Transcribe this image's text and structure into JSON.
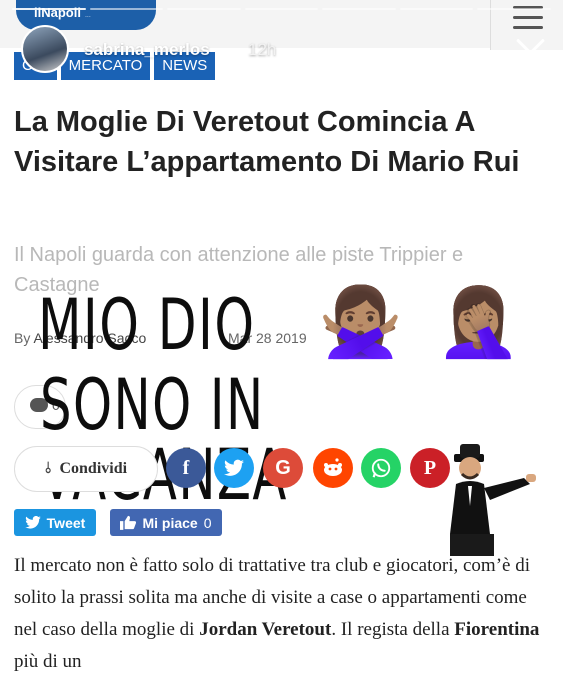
{
  "story": {
    "username": "sabrina_merlos",
    "time": "12h"
  },
  "site": {
    "logo": "ilNapoli",
    "logo_sub": "..."
  },
  "article": {
    "tags": [
      "CIO",
      "MERCATO",
      "NEWS"
    ],
    "title": "La Moglie Di Veretout Comincia A Visitare L’appartamento Di Mario Rui",
    "subtitle": "Il Napoli guarda con attenzione alle piste Trippier e Castagne",
    "byline_prefix": "By",
    "author": "Alessandro Sacco",
    "date": "Mar 28 2019",
    "comments_count": "0",
    "share_label": "Condividi",
    "tweet_label": "Tweet",
    "like_label": "Mi piace",
    "like_count": "0",
    "body": {
      "p1": "Il mercato non è fatto solo di trattative tra club e giocatori, com’è di solito la prassi solita ma anche di visite a case o appartamenti come nel caso della moglie di ",
      "b1": "Jordan Veretout",
      "p2": ". Il regista della ",
      "b2": "Fiorentina",
      "p3": " più di un"
    }
  },
  "overlay": {
    "line1": "MIO DIO",
    "line2": "SONO IN VACANZA",
    "emoji1": "🙅🏽‍♀️",
    "emoji2": "🤦🏽‍♀️"
  },
  "social_icons": [
    "facebook-icon",
    "twitter-icon",
    "google-icon",
    "reddit-icon",
    "whatsapp-icon",
    "pinterest-icon"
  ],
  "colors": {
    "tag_blue": "#1a62b5",
    "facebook": "#3b5998",
    "twitter": "#1da1f2",
    "google": "#dd4b39",
    "reddit": "#ff4500",
    "whatsapp": "#25d366",
    "pinterest": "#cb2027"
  }
}
